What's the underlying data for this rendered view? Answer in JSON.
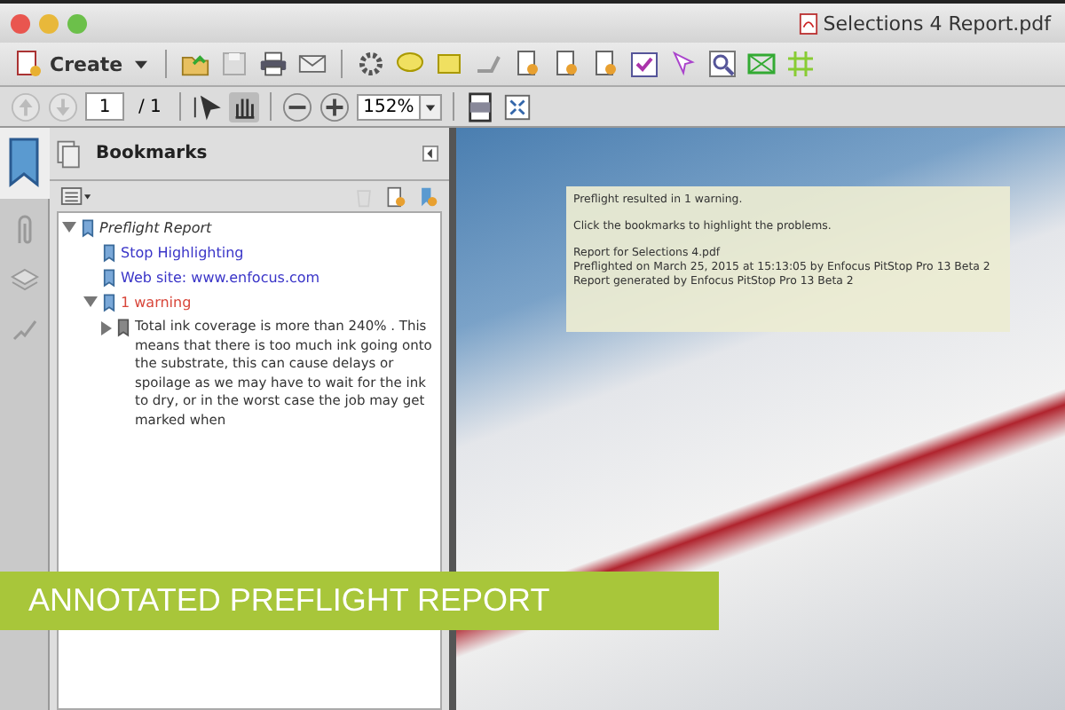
{
  "window": {
    "title": "Selections 4 Report.pdf"
  },
  "toolbar": {
    "create_label": "Create"
  },
  "nav_bar": {
    "page": "1",
    "page_total": "/ 1",
    "zoom": "152%"
  },
  "bookmarks_panel": {
    "title": "Bookmarks",
    "tree": [
      {
        "label": "Preflight Report",
        "expanded": true,
        "children": [
          {
            "label": "Stop Highlighting",
            "color": "#3a35c8"
          },
          {
            "label": "Web site: www.enfocus.com",
            "color": "#3a35c8"
          },
          {
            "label": "1 warning",
            "color": "#d8463a",
            "expanded": true,
            "children": [
              {
                "label": "Total ink coverage is more than 240% .  This means that there is too much ink going onto the substrate, this can cause delays or spoilage as we may have to wait for the ink to dry, or in the worst case the job may get marked when",
                "expanded": false
              }
            ]
          }
        ]
      }
    ]
  },
  "note": {
    "paragraphs": [
      [
        "Preflight resulted in 1 warning."
      ],
      [
        "Click the bookmarks to highlight the problems."
      ],
      [
        "Report for Selections 4.pdf",
        "Preflighted on March 25, 2015 at 15:13:05 by Enfocus PitStop Pro 13 Beta 2",
        "Report generated by Enfocus PitStop Pro 13 Beta 2"
      ]
    ]
  },
  "banner": {
    "text": "ANNOTATED PREFLIGHT REPORT"
  }
}
